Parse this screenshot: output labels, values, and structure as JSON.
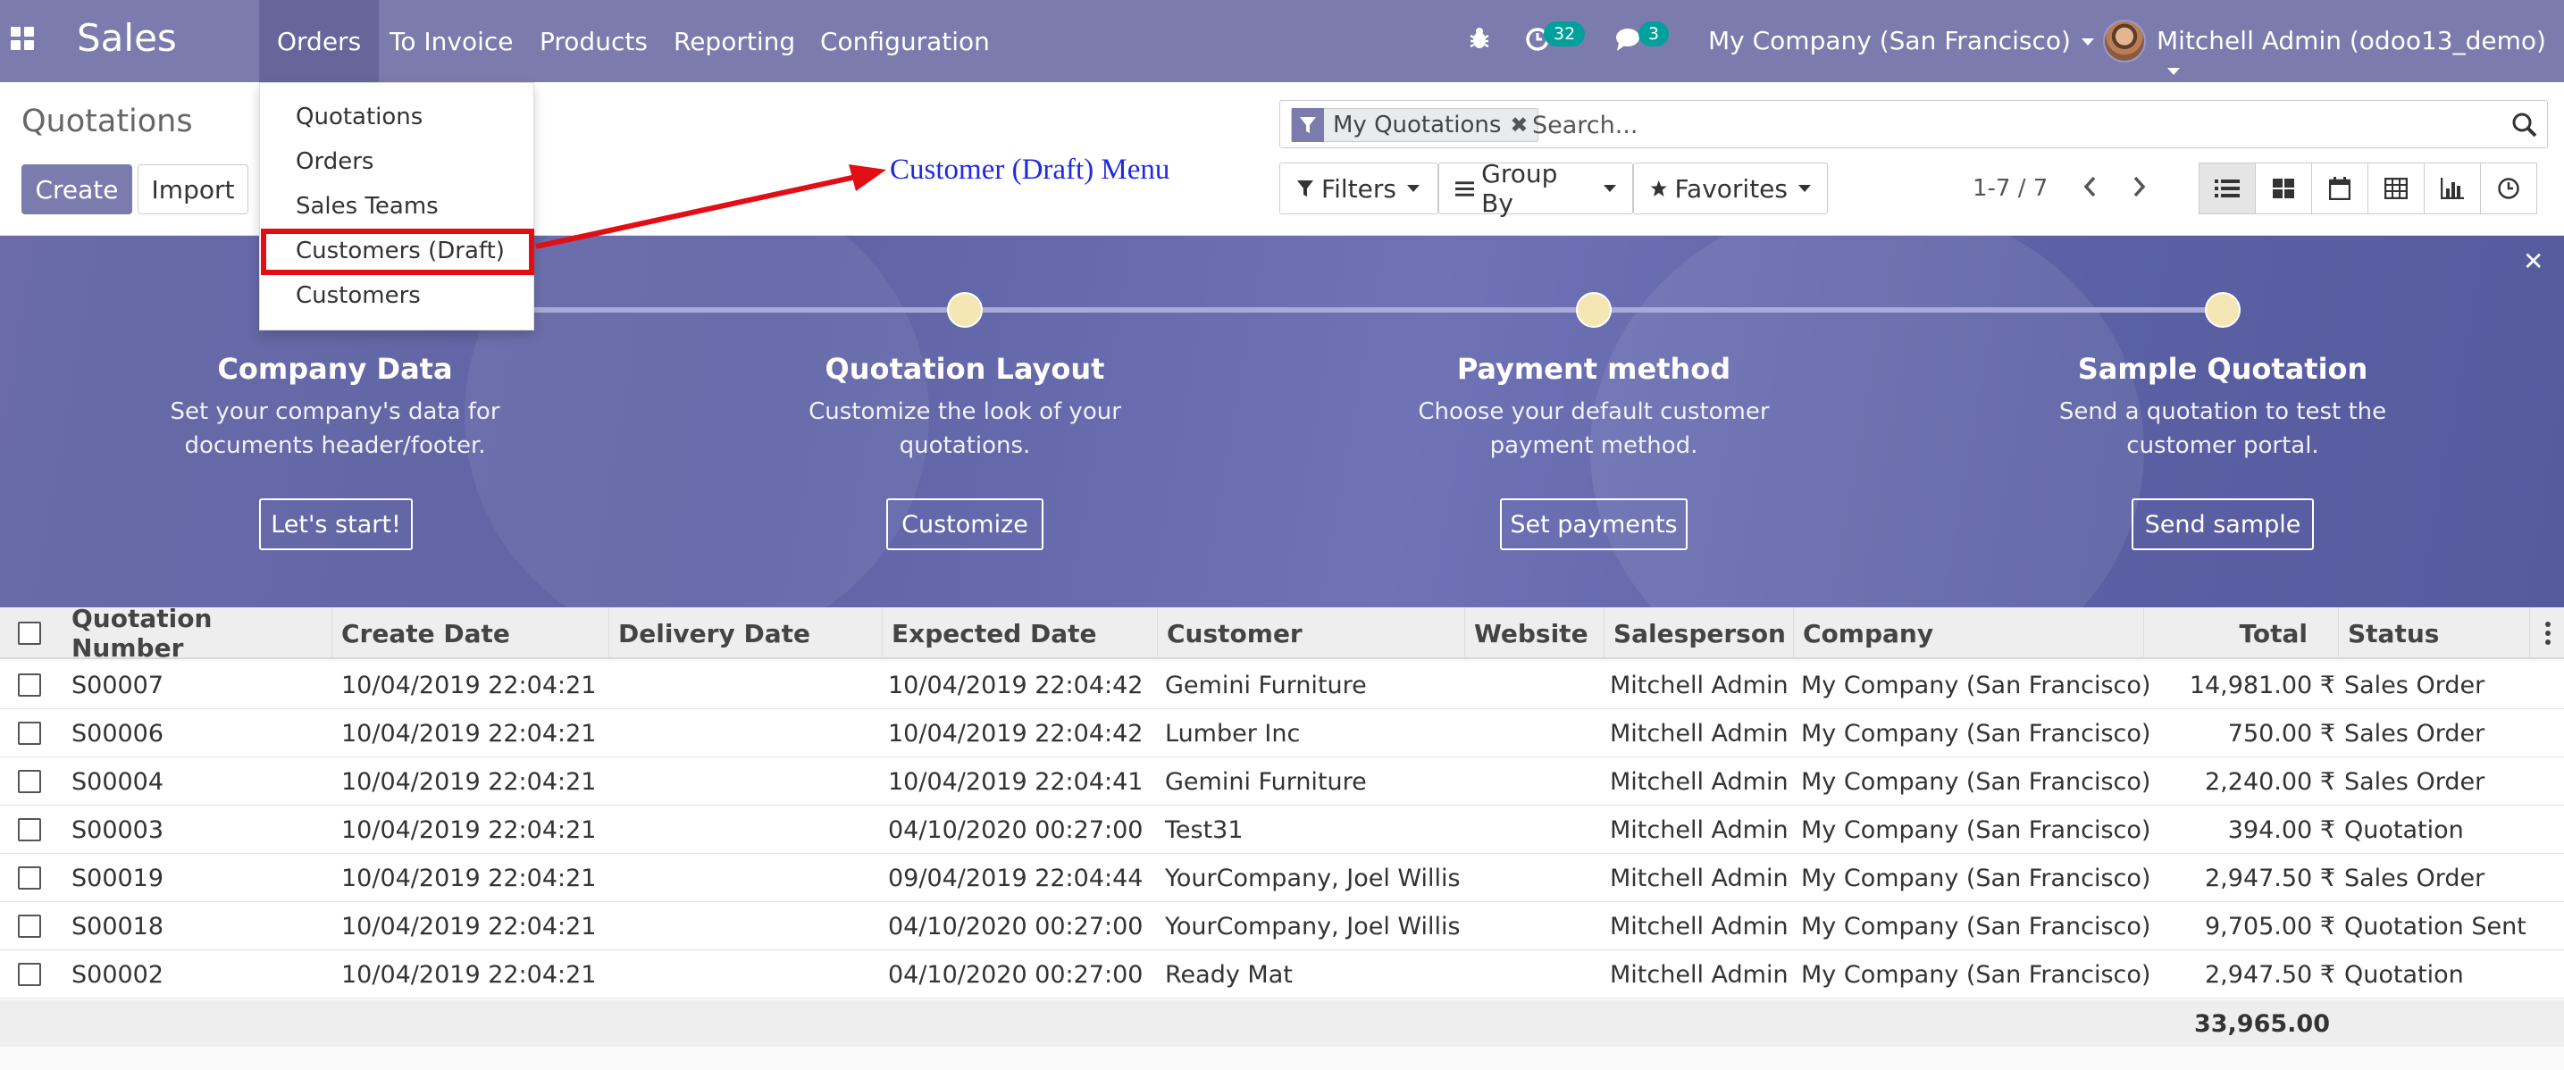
{
  "navbar": {
    "brand": "Sales",
    "menus": [
      "Orders",
      "To Invoice",
      "Products",
      "Reporting",
      "Configuration"
    ],
    "activity_count": "32",
    "message_count": "3",
    "company": "My Company (San Francisco)",
    "user": "Mitchell Admin (odoo13_demo)"
  },
  "dropdown": {
    "items": [
      "Quotations",
      "Orders",
      "Sales Teams",
      "Customers (Draft)",
      "Customers"
    ]
  },
  "annotation": {
    "text": "Customer (Draft) Menu",
    "color": "#1f29e2",
    "box_color": "#e20e14"
  },
  "control_panel": {
    "breadcrumb": "Quotations",
    "create_label": "Create",
    "import_label": "Import",
    "facet_label": "My Quotations",
    "search_placeholder": "Search...",
    "filters_label": "Filters",
    "groupby_label": "Group By",
    "favorites_label": "Favorites",
    "pager": "1-7 / 7"
  },
  "banner": {
    "steps": [
      {
        "title": "Company Data",
        "desc1": "Set your company's data for",
        "desc2": "documents header/footer.",
        "button": "Let's start!"
      },
      {
        "title": "Quotation Layout",
        "desc1": "Customize the look of your",
        "desc2": "quotations.",
        "button": "Customize"
      },
      {
        "title": "Payment method",
        "desc1": "Choose your default customer",
        "desc2": "payment method.",
        "button": "Set payments"
      },
      {
        "title": "Sample Quotation",
        "desc1": "Send a quotation to test the",
        "desc2": "customer portal.",
        "button": "Send sample"
      }
    ]
  },
  "table": {
    "columns": [
      "Quotation Number",
      "Create Date",
      "Delivery Date",
      "Expected Date",
      "Customer",
      "Website",
      "Salesperson",
      "Company",
      "Total",
      "Status"
    ],
    "rows": [
      {
        "number": "S00007",
        "create": "10/04/2019 22:04:21",
        "delivery": "",
        "expected": "10/04/2019 22:04:42",
        "customer": "Gemini Furniture",
        "website": "",
        "salesperson": "Mitchell Admin",
        "company": "My Company (San Francisco)",
        "total": "14,981.00 ₹",
        "status": "Sales Order"
      },
      {
        "number": "S00006",
        "create": "10/04/2019 22:04:21",
        "delivery": "",
        "expected": "10/04/2019 22:04:42",
        "customer": "Lumber Inc",
        "website": "",
        "salesperson": "Mitchell Admin",
        "company": "My Company (San Francisco)",
        "total": "750.00 ₹",
        "status": "Sales Order"
      },
      {
        "number": "S00004",
        "create": "10/04/2019 22:04:21",
        "delivery": "",
        "expected": "10/04/2019 22:04:41",
        "customer": "Gemini Furniture",
        "website": "",
        "salesperson": "Mitchell Admin",
        "company": "My Company (San Francisco)",
        "total": "2,240.00 ₹",
        "status": "Sales Order"
      },
      {
        "number": "S00003",
        "create": "10/04/2019 22:04:21",
        "delivery": "",
        "expected": "04/10/2020 00:27:00",
        "customer": "Test31",
        "website": "",
        "salesperson": "Mitchell Admin",
        "company": "My Company (San Francisco)",
        "total": "394.00 ₹",
        "status": "Quotation"
      },
      {
        "number": "S00019",
        "create": "10/04/2019 22:04:21",
        "delivery": "",
        "expected": "09/04/2019 22:04:44",
        "customer": "YourCompany, Joel Willis",
        "website": "",
        "salesperson": "Mitchell Admin",
        "company": "My Company (San Francisco)",
        "total": "2,947.50 ₹",
        "status": "Sales Order"
      },
      {
        "number": "S00018",
        "create": "10/04/2019 22:04:21",
        "delivery": "",
        "expected": "04/10/2020 00:27:00",
        "customer": "YourCompany, Joel Willis",
        "website": "",
        "salesperson": "Mitchell Admin",
        "company": "My Company (San Francisco)",
        "total": "9,705.00 ₹",
        "status": "Quotation Sent"
      },
      {
        "number": "S00002",
        "create": "10/04/2019 22:04:21",
        "delivery": "",
        "expected": "04/10/2020 00:27:00",
        "customer": "Ready Mat",
        "website": "",
        "salesperson": "Mitchell Admin",
        "company": "My Company (San Francisco)",
        "total": "2,947.50 ₹",
        "status": "Quotation"
      }
    ],
    "footer_total": "33,965.00"
  }
}
